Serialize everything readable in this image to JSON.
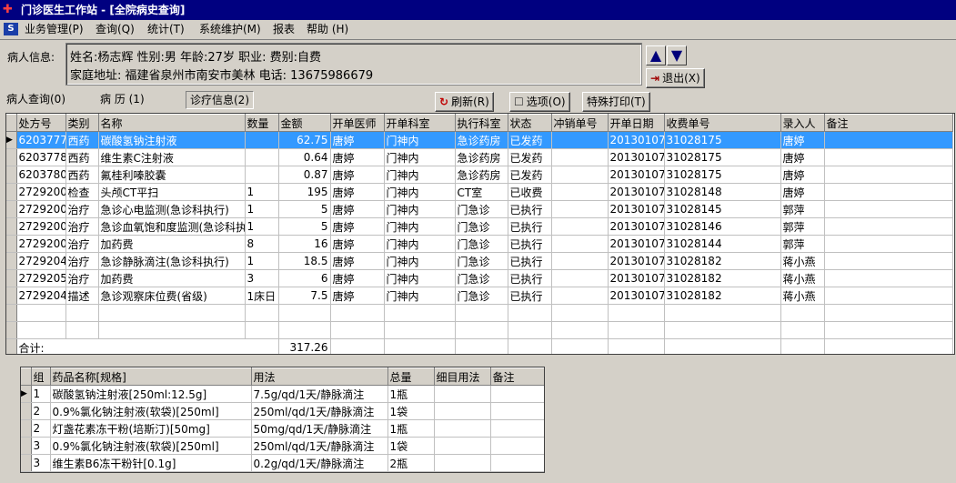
{
  "window": {
    "title": "门诊医生工作站 - [全院病史查询]"
  },
  "menu": [
    "业务管理(P)",
    "查询(Q)",
    "统计(T)",
    "系统维护(M)",
    "报表",
    "帮助 (H)"
  ],
  "patient": {
    "label": "病人信息:",
    "line1": "姓名:杨志辉 性别:男 年龄:27岁  职业:  费别:自费",
    "line2": "家庭地址: 福建省泉州市南安市美林 电话: 13675986679"
  },
  "buttons": {
    "exit": "退出(X)",
    "refresh": "刷新(R)",
    "options": "选项(O)",
    "special_print": "特殊打印(T)"
  },
  "tabs": [
    "病人查询(0)",
    "病 历 (1)",
    "诊疗信息(2)"
  ],
  "orders": {
    "columns": [
      "处方号",
      "类别",
      "名称",
      "数量",
      "金额",
      "开单医师",
      "开单科室",
      "执行科室",
      "状态",
      "冲销单号",
      "开单日期",
      "收费单号",
      "录入人",
      "备注"
    ],
    "rows": [
      [
        "6203777",
        "西药",
        "碳酸氢钠注射液",
        "",
        "62.75",
        "唐婷",
        "门神内",
        "急诊药房",
        "已发药",
        "",
        "20130107",
        "31028175",
        "唐婷",
        ""
      ],
      [
        "6203778",
        "西药",
        "维生素C注射液",
        "",
        "0.64",
        "唐婷",
        "门神内",
        "急诊药房",
        "已发药",
        "",
        "20130107",
        "31028175",
        "唐婷",
        ""
      ],
      [
        "6203780",
        "西药",
        "氟桂利嗪胶囊",
        "",
        "0.87",
        "唐婷",
        "门神内",
        "急诊药房",
        "已发药",
        "",
        "20130107",
        "31028175",
        "唐婷",
        ""
      ],
      [
        "2729200",
        "检查",
        "头颅CT平扫",
        "1",
        "195",
        "唐婷",
        "门神内",
        "CT室",
        "已收费",
        "",
        "20130107",
        "31028148",
        "唐婷",
        ""
      ],
      [
        "2729200",
        "治疗",
        "急诊心电监测(急诊科执行)",
        "1",
        "5",
        "唐婷",
        "门神内",
        "门急诊",
        "已执行",
        "",
        "20130107",
        "31028145",
        "郭萍",
        ""
      ],
      [
        "2729200",
        "治疗",
        "急诊血氧饱和度监测(急诊科执行)",
        "1",
        "5",
        "唐婷",
        "门神内",
        "门急诊",
        "已执行",
        "",
        "20130107",
        "31028146",
        "郭萍",
        ""
      ],
      [
        "2729200",
        "治疗",
        "加药费",
        "8",
        "16",
        "唐婷",
        "门神内",
        "门急诊",
        "已执行",
        "",
        "20130107",
        "31028144",
        "郭萍",
        ""
      ],
      [
        "2729204",
        "治疗",
        "急诊静脉滴注(急诊科执行)",
        "1",
        "18.5",
        "唐婷",
        "门神内",
        "门急诊",
        "已执行",
        "",
        "20130107",
        "31028182",
        "蒋小燕",
        ""
      ],
      [
        "2729205",
        "治疗",
        "加药费",
        "3",
        "6",
        "唐婷",
        "门神内",
        "门急诊",
        "已执行",
        "",
        "20130107",
        "31028182",
        "蒋小燕",
        ""
      ],
      [
        "2729204",
        "描述",
        "急诊观察床位费(省级)",
        "1床日",
        "7.5",
        "唐婷",
        "门神内",
        "门急诊",
        "已执行",
        "",
        "20130107",
        "31028182",
        "蒋小燕",
        ""
      ]
    ],
    "total_label": "合计:",
    "total_value": "317.26"
  },
  "details": {
    "columns": [
      "组",
      "药品名称[规格]",
      "用法",
      "总量",
      "细目用法",
      "备注"
    ],
    "rows": [
      [
        "1",
        "碳酸氢钠注射液[250ml:12.5g]",
        "7.5g/qd/1天/静脉滴注",
        "1瓶",
        "",
        ""
      ],
      [
        "2",
        "0.9%氯化钠注射液(软袋)[250ml]",
        "250ml/qd/1天/静脉滴注",
        "1袋",
        "",
        ""
      ],
      [
        "2",
        "灯盏花素冻干粉(培斯汀)[50mg]",
        "50mg/qd/1天/静脉滴注",
        "1瓶",
        "",
        ""
      ],
      [
        "3",
        "0.9%氯化钠注射液(软袋)[250ml]",
        "250ml/qd/1天/静脉滴注",
        "1袋",
        "",
        ""
      ],
      [
        "3",
        "维生素B6冻干粉针[0.1g]",
        "0.2g/qd/1天/静脉滴注",
        "2瓶",
        "",
        ""
      ]
    ]
  }
}
